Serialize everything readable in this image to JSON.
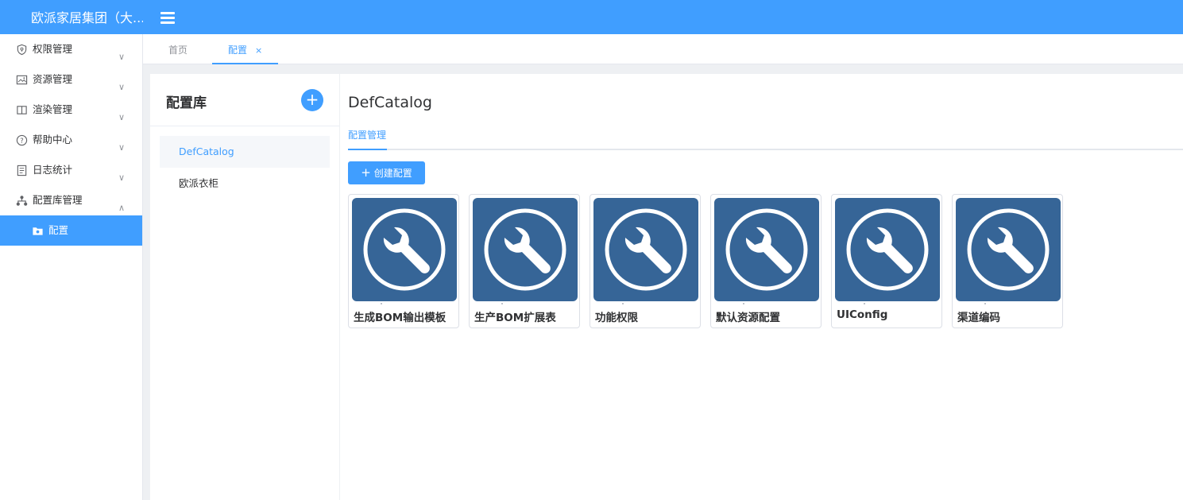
{
  "header": {
    "brand": "欧派家居集团（大..."
  },
  "sidebar": {
    "items": [
      {
        "label": "权限管理",
        "arrow": "∨"
      },
      {
        "label": "资源管理",
        "arrow": "∨"
      },
      {
        "label": "渲染管理",
        "arrow": "∨"
      },
      {
        "label": "帮助中心",
        "arrow": "∨"
      },
      {
        "label": "日志统计",
        "arrow": "∨"
      },
      {
        "label": "配置库管理",
        "arrow": "∧"
      },
      {
        "label": "配置"
      }
    ]
  },
  "tabs": {
    "home": "首页",
    "config": "配置",
    "close": "×"
  },
  "catalog": {
    "title": "配置库",
    "add": "+",
    "items": [
      "DefCatalog",
      "欧派衣柜"
    ]
  },
  "main": {
    "title": "DefCatalog",
    "subtab": "配置管理",
    "create_icon": "+",
    "create_label": "创建配置",
    "cards": [
      "生成BOM输出模板",
      "生产BOM扩展表",
      "功能权限",
      "默认资源配置",
      "UIConfig",
      "渠道编码"
    ]
  },
  "colors": {
    "accent": "#409eff",
    "card_icon_bg": "#366597"
  }
}
